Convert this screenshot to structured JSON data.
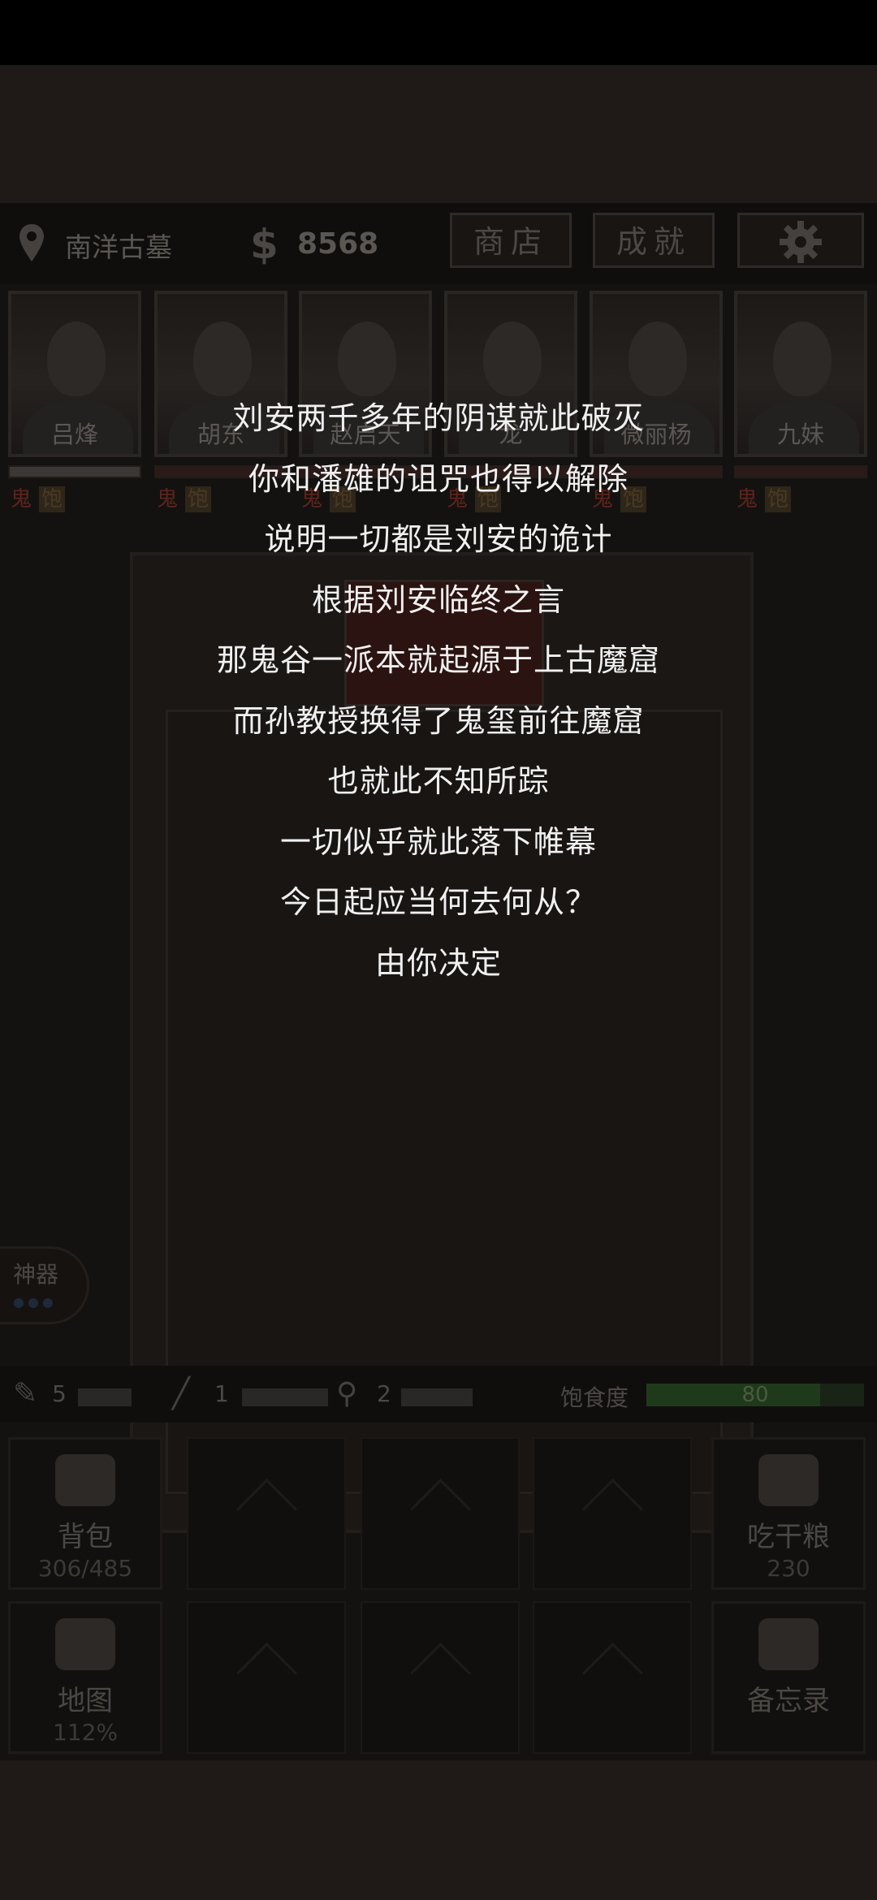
{
  "top_bar": {
    "location": "南洋古墓",
    "currency_symbol": "$",
    "money": "8568",
    "shop_label": "商店",
    "achievement_label": "成就",
    "settings_icon": "gear-icon"
  },
  "characters": [
    {
      "name": "吕烽",
      "tag_ghost": "鬼",
      "tag_full": "饱"
    },
    {
      "name": "胡东",
      "tag_ghost": "鬼",
      "tag_full": "饱"
    },
    {
      "name": "赵启天",
      "tag_ghost": "鬼",
      "tag_full": "饱"
    },
    {
      "name": "龙",
      "tag_ghost": "鬼",
      "tag_full": "饱"
    },
    {
      "name": "微丽杨",
      "tag_ghost": "鬼",
      "tag_full": "饱"
    },
    {
      "name": "九妹",
      "tag_ghost": "鬼",
      "tag_full": "饱"
    }
  ],
  "story": {
    "lines": [
      "刘安两千多年的阴谋就此破灭",
      "你和潘雄的诅咒也得以解除",
      "说明一切都是刘安的诡计",
      "根据刘安临终之言",
      "那鬼谷一派本就起源于上古魔窟",
      "而孙教授换得了鬼玺前往魔窟",
      "也就此不知所踪",
      "一切似乎就此落下帷幕",
      "今日起应当何去何从？",
      "由你决定"
    ]
  },
  "artifact": {
    "label": "神器"
  },
  "tools": {
    "torch_count": "5",
    "rope_count": "1",
    "shovel_count": "2",
    "satiety_label": "饱食度",
    "satiety_value": "80",
    "satiety_fraction": 0.8
  },
  "grid": {
    "backpack_label": "背包",
    "backpack_sub": "306/485",
    "eat_label": "吃干粮",
    "eat_sub": "230",
    "map_label": "地图",
    "map_sub": "112%",
    "memo_label": "备忘录"
  },
  "colors": {
    "ghost_tag": "#5c241c",
    "satiety_bar": "#1f3a1a"
  }
}
